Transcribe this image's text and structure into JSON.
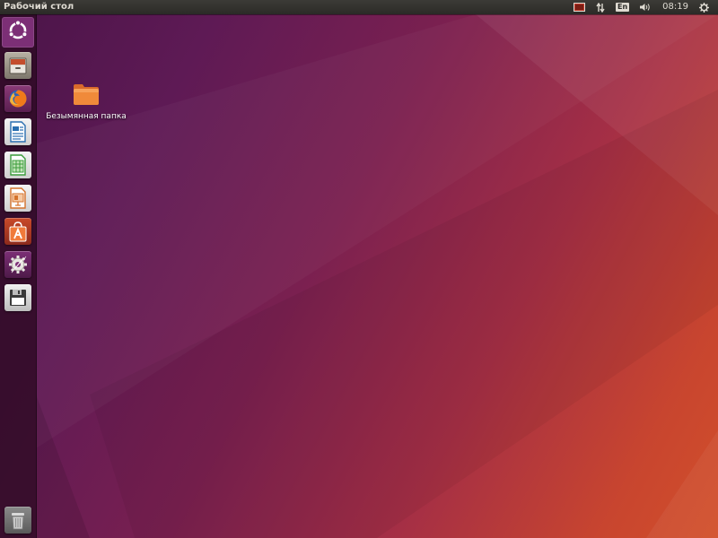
{
  "top_panel": {
    "title": "Рабочий стол",
    "indicators": [
      {
        "icon": "display-indicator-icon"
      },
      {
        "icon": "network-transfer-icon"
      },
      {
        "icon": "keyboard-layout-icon",
        "label": "En"
      },
      {
        "icon": "volume-icon"
      },
      {
        "icon": "clock",
        "label": "08:19"
      },
      {
        "icon": "system-gear-icon"
      }
    ]
  },
  "launcher": {
    "items": [
      {
        "name": "dash-home",
        "icon": "ubuntu-logo-icon",
        "accent": "#7c2f76"
      },
      {
        "name": "files",
        "icon": "file-cabinet-icon",
        "accent": "#9a9386"
      },
      {
        "name": "firefox",
        "icon": "firefox-icon",
        "accent": "#e66000"
      },
      {
        "name": "libreoffice-writer",
        "icon": "writer-document-icon",
        "accent": "#2a6fb0"
      },
      {
        "name": "libreoffice-calc",
        "icon": "calc-spreadsheet-icon",
        "accent": "#3b9c3b"
      },
      {
        "name": "libreoffice-impress",
        "icon": "impress-presentation-icon",
        "accent": "#d4722b"
      },
      {
        "name": "software-center",
        "icon": "shopping-bag-icon",
        "accent": "#e95420"
      },
      {
        "name": "system-settings",
        "icon": "settings-wrench-icon",
        "accent": "#d63a2b"
      },
      {
        "name": "install-disk",
        "icon": "floppy-disk-icon",
        "accent": "#4a4a4a"
      },
      {
        "name": "trash",
        "icon": "trash-icon",
        "accent": "#7a7a7a"
      }
    ]
  },
  "desktop": {
    "items": [
      {
        "label": "Безымянная папка",
        "icon": "folder-icon"
      }
    ]
  },
  "colors": {
    "panel": "#2b2a27",
    "ubuntu_orange": "#e95420",
    "aubergine": "#5e2750"
  }
}
